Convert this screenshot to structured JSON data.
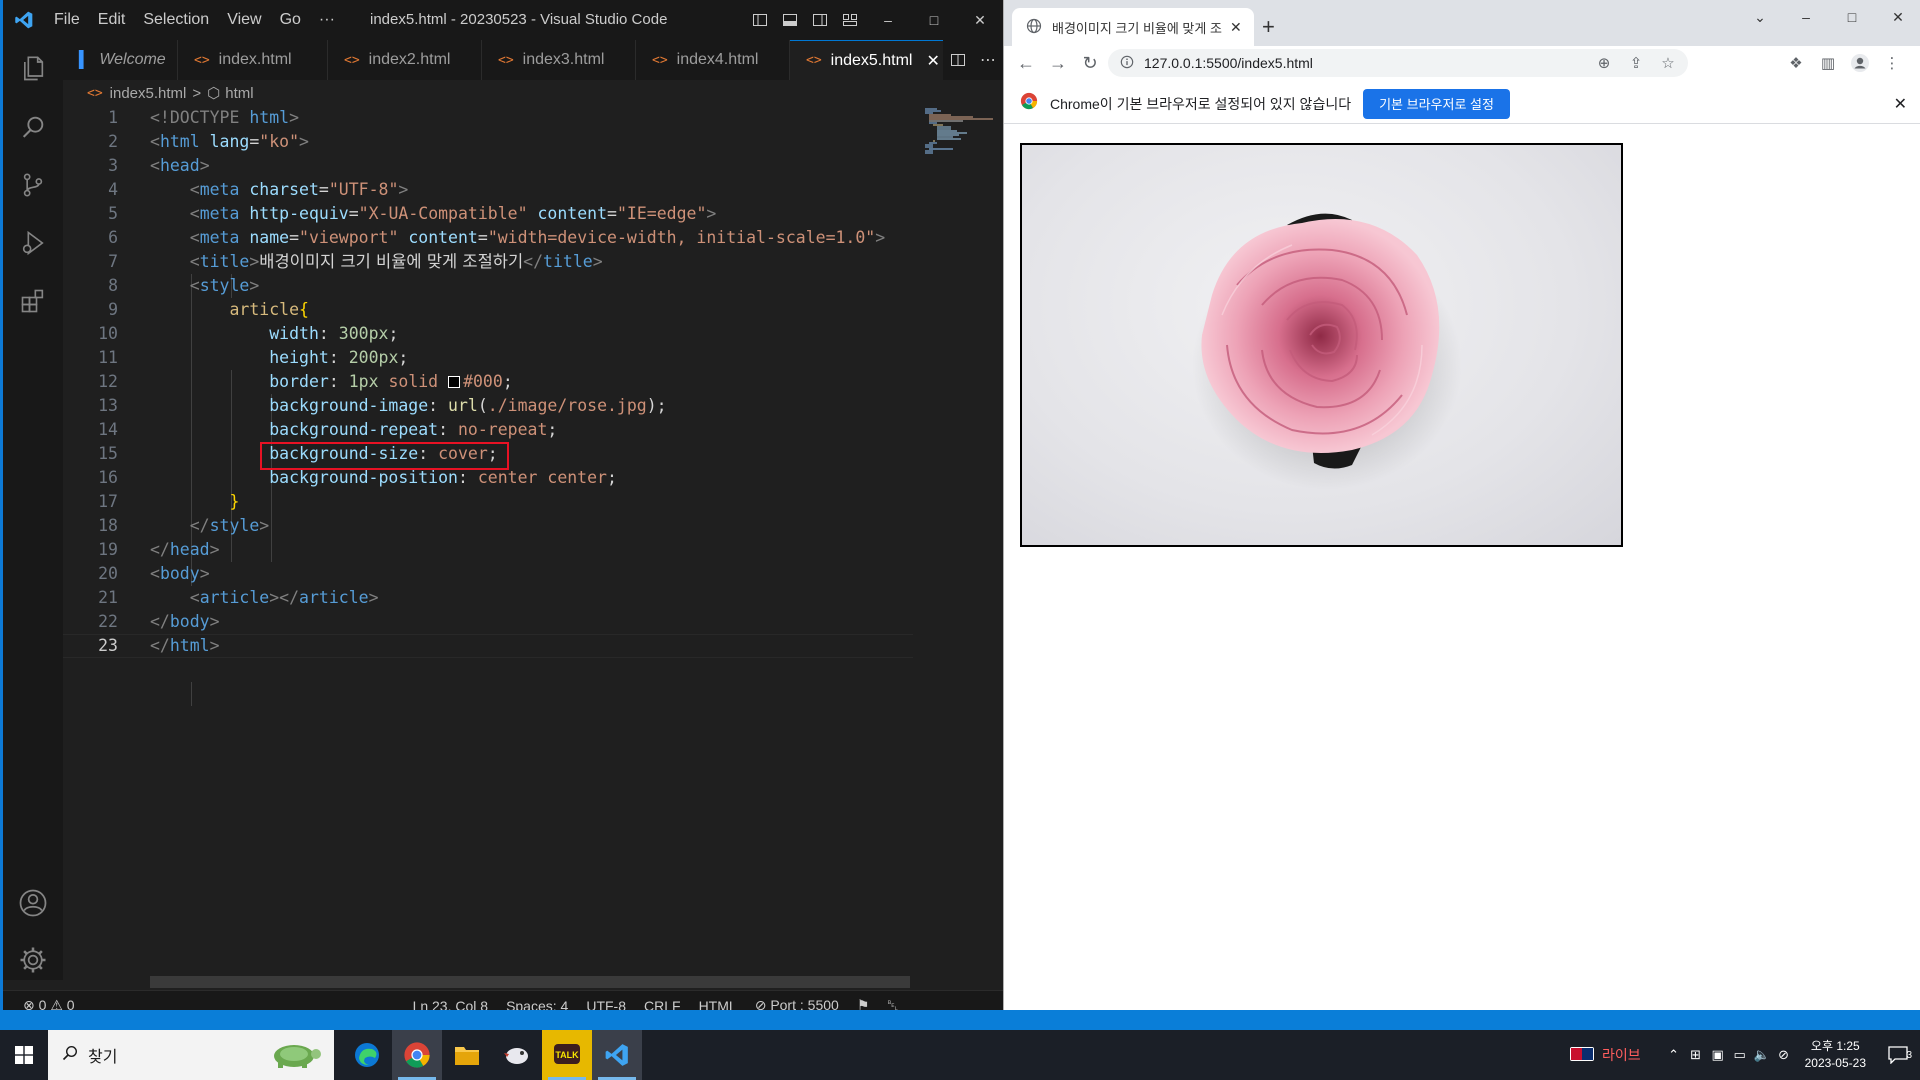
{
  "vscode": {
    "title": "index5.html - 20230523 - Visual Studio Code",
    "menu": [
      "File",
      "Edit",
      "Selection",
      "View",
      "Go",
      "···"
    ],
    "tabs": [
      {
        "label": "Welcome"
      },
      {
        "label": "index.html"
      },
      {
        "label": "index2.html"
      },
      {
        "label": "index3.html"
      },
      {
        "label": "index4.html"
      },
      {
        "label": "index5.html"
      }
    ],
    "active_tab": "index5.html",
    "breadcrumb": {
      "file": "index5.html",
      "sep": ">",
      "symbol": "html"
    },
    "line_numbers": [
      "1",
      "2",
      "3",
      "4",
      "5",
      "6",
      "7",
      "8",
      "9",
      "10",
      "11",
      "12",
      "13",
      "14",
      "15",
      "16",
      "17",
      "18",
      "19",
      "20",
      "21",
      "22",
      "23"
    ],
    "code": {
      "l1_doctype": "<!DOCTYPE",
      "l1_html": " html",
      "l2_tag": "<html",
      "l2_attr": " lang",
      "l2_val": "\"ko\"",
      "l4_attr": " charset",
      "l4_val": "\"UTF-8\"",
      "l5_attr1": " http-equiv",
      "l5_val1": "\"X-UA-Compatible\"",
      "l5_attr2": " content",
      "l5_val2": "\"IE=edge\"",
      "l6_attr1": " name",
      "l6_val1": "\"viewport\"",
      "l6_attr2": " content",
      "l6_val2": "\"width=device-width, initial-scale=1.0\"",
      "l7_text": "배경이미지 크기 비율에 맞게 조절하기",
      "l9_sel": "article",
      "l10_prop": "width",
      "l10_val": "300px",
      "l11_prop": "height",
      "l11_val": "200px",
      "l12_prop": "border",
      "l12_val1": "1px",
      "l12_val2": " solid ",
      "l12_val3": "#000",
      "l13_prop": "background-image",
      "l13_fn": "url",
      "l13_val": "./image/rose.jpg",
      "l14_prop": "background-repeat",
      "l14_val": "no-repeat",
      "l15_prop": "background-size",
      "l15_val": "cover",
      "l16_prop": "background-position",
      "l16_val": "center center"
    },
    "status": {
      "errors": "0",
      "warnings": "0",
      "position": "Ln 23, Col 8",
      "spaces": "Spaces: 4",
      "encoding": "UTF-8",
      "eol": "CRLF",
      "language": "HTML",
      "port": "Port : 5500"
    }
  },
  "chrome": {
    "tab_title": "배경이미지 크기 비율에 맞게 조",
    "url": "127.0.0.1:5500/index5.html",
    "infobar_text": "Chrome이 기본 브라우저로 설정되어 있지 않습니다",
    "infobar_button": "기본 브라우저로 설정"
  },
  "taskbar": {
    "search_label": "찾기",
    "live_label": "라이브",
    "time": "오후 1:25",
    "date": "2023-05-23",
    "notification_count": "3"
  },
  "colors": {
    "vscode_bg": "#1f1f1f",
    "accent_blue": "#0078d4",
    "highlight_red": "#e81224",
    "chrome_button": "#1a73e8"
  }
}
